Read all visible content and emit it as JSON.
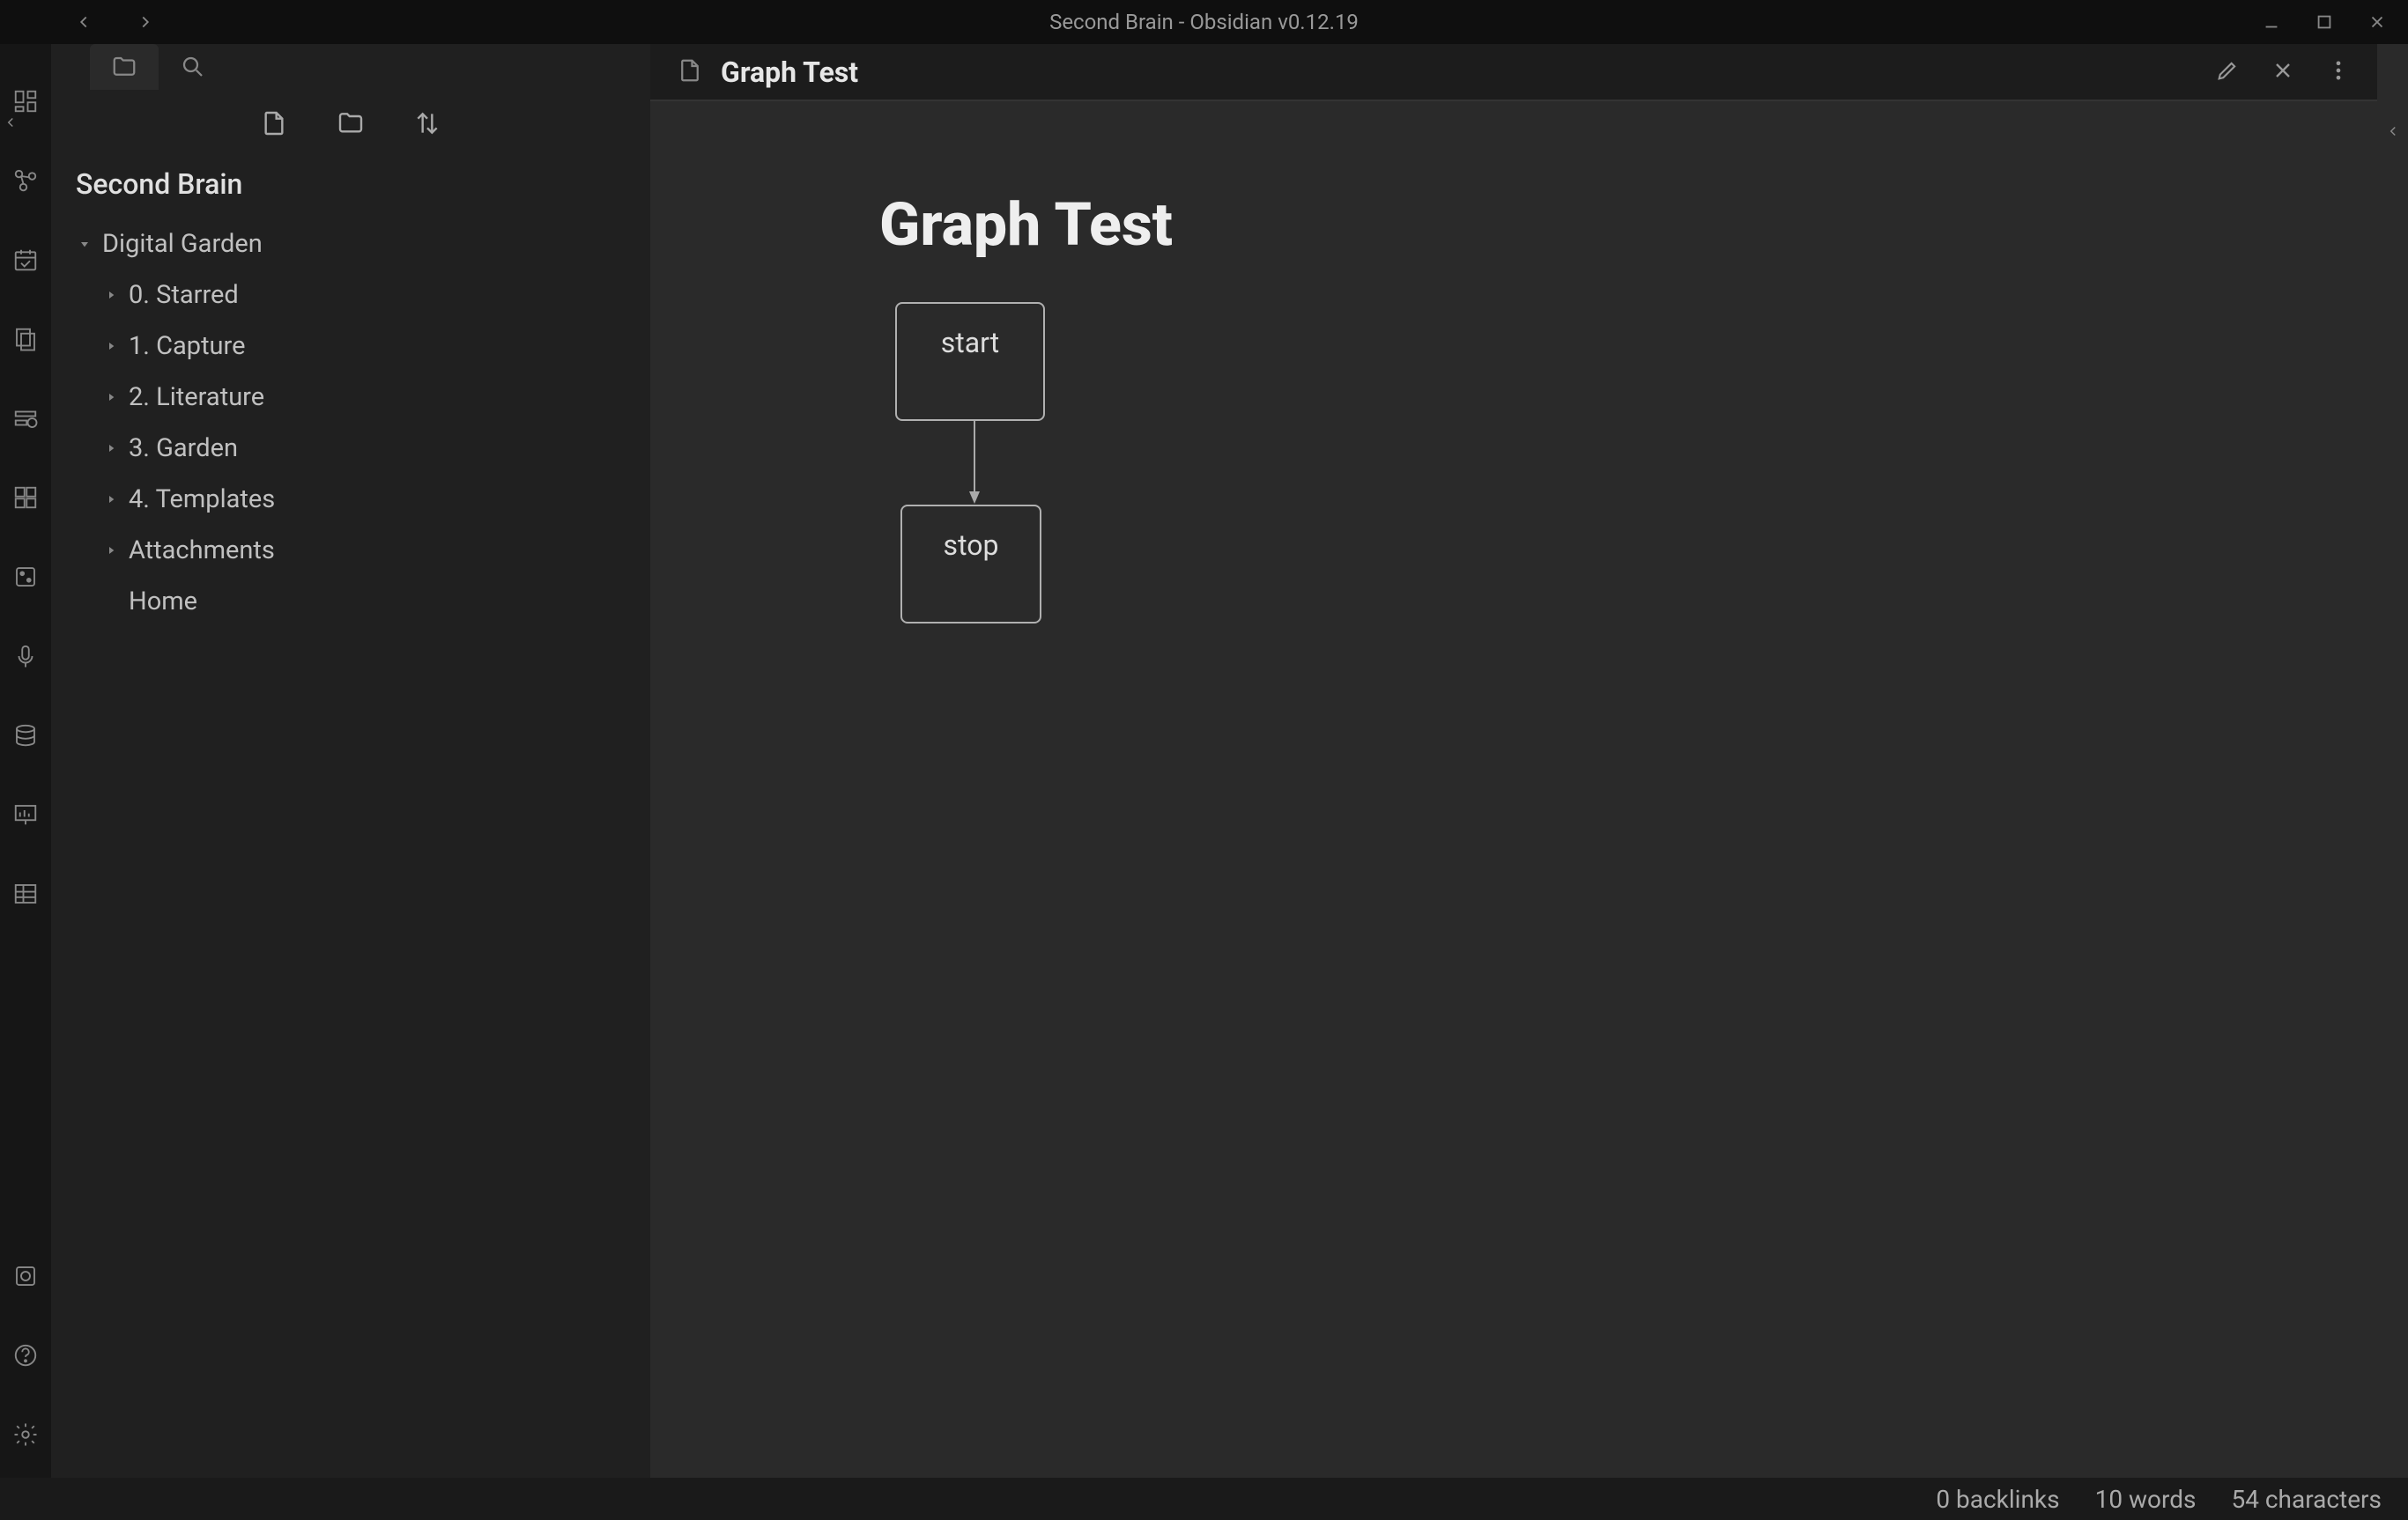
{
  "window": {
    "title": "Second Brain - Obsidian v0.12.19"
  },
  "vault": {
    "name": "Second Brain"
  },
  "fileTree": {
    "root": {
      "label": "Digital Garden",
      "expanded": true,
      "children": [
        {
          "label": "0. Starred"
        },
        {
          "label": "1. Capture"
        },
        {
          "label": "2. Literature"
        },
        {
          "label": "3. Garden"
        },
        {
          "label": "4. Templates"
        },
        {
          "label": "Attachments"
        }
      ],
      "files": [
        {
          "label": "Home"
        }
      ]
    }
  },
  "tab": {
    "title": "Graph Test"
  },
  "note": {
    "heading": "Graph Test",
    "diagram": {
      "node1": "start",
      "node2": "stop"
    }
  },
  "status": {
    "backlinks": "0 backlinks",
    "words": "10 words",
    "chars": "54 characters"
  }
}
